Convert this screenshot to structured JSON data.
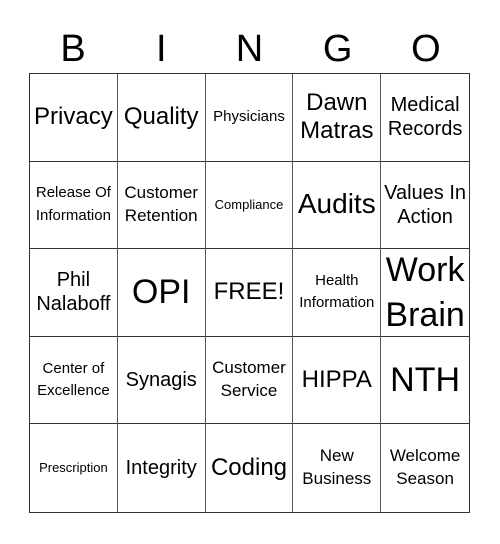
{
  "header": [
    "B",
    "I",
    "N",
    "G",
    "O"
  ],
  "cells": [
    "Privacy",
    "Quality",
    "Physicians",
    "Dawn Matras",
    "Medical Records",
    "Release Of Information",
    "Customer Retention",
    "Compliance",
    "Audits",
    "Values In Action",
    "Phil Nalaboff",
    "OPI",
    "FREE!",
    "Health Information",
    "Work Brain",
    "Center of Excellence",
    "Synagis",
    "Customer Service",
    "HIPPA",
    "NTH",
    "Prescription",
    "Integrity",
    "Coding",
    "New Business",
    "Welcome Season"
  ]
}
